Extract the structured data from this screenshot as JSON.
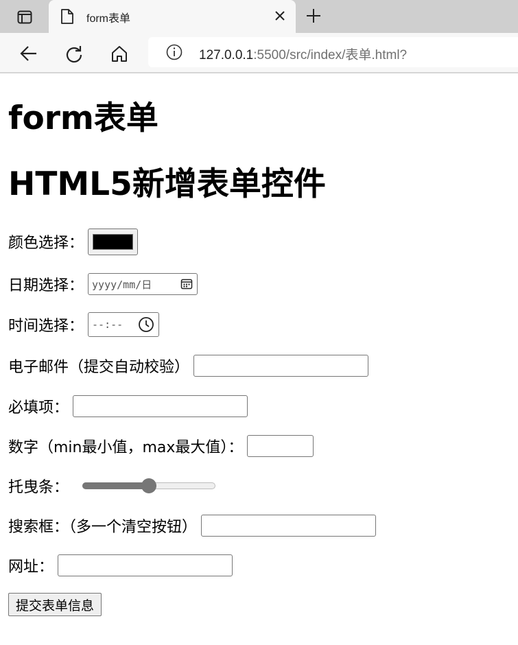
{
  "browser": {
    "tab_title": "form表单",
    "url_host": "127.0.0.1",
    "url_rest": ":5500/src/index/表单.html?"
  },
  "page": {
    "heading1": "form表单",
    "heading2": "HTML5新增表单控件",
    "fields": {
      "color": {
        "label": "颜色选择：",
        "value": "#000000"
      },
      "date": {
        "label": "日期选择：",
        "placeholder": "yyyy/mm/日"
      },
      "time": {
        "label": "时间选择：",
        "placeholder": "--:--"
      },
      "email": {
        "label": "电子邮件（提交自动校验）",
        "value": ""
      },
      "required": {
        "label": "必填项：",
        "value": ""
      },
      "number": {
        "label": "数字（min最小值，max最大值）：",
        "value": ""
      },
      "range": {
        "label": "托曳条：",
        "value": 0.5
      },
      "search": {
        "label": "搜索框：（多一个清空按钮）",
        "value": ""
      },
      "url": {
        "label": "网址：",
        "value": ""
      }
    },
    "submit_label": "提交表单信息"
  }
}
